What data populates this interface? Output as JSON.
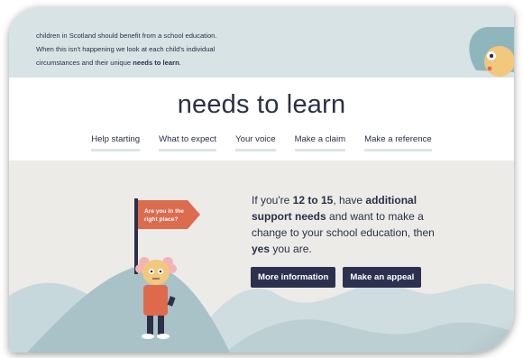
{
  "banner": {
    "intro_line1": "children in Scotland should benefit from a school education.",
    "intro_line2": "When this isn't happening we look at each child's individual",
    "intro_line3_start": "circumstances and their unique ",
    "intro_line3_bold": "needs to learn",
    "intro_line3_end": "."
  },
  "page": {
    "title": "needs to learn"
  },
  "nav": {
    "items": [
      "Help starting",
      "What to expect",
      "Your voice",
      "Make a claim",
      "Make a reference"
    ]
  },
  "hero": {
    "flag_line1": "Are you in the",
    "flag_line2": "right place?",
    "text": {
      "p1": "If you're ",
      "b1": "12 to 15",
      "p2": ", have ",
      "b2": "additional support needs",
      "p3": " and want to make a change to your school education, then ",
      "b3": "yes",
      "p4": " you are."
    },
    "buttons": {
      "more_info": "More information",
      "appeal": "Make an appeal"
    }
  },
  "colors": {
    "navy": "#2b3048",
    "button": "#2d3150",
    "banner_bg": "#d7e3e5",
    "hero_bg": "#ecebe7",
    "hill": "#a9c2c7",
    "flag": "#dd6b4e",
    "character_body": "#df6a4b"
  },
  "icons": [
    "flag-icon",
    "character-illustration",
    "banner-face-illustration"
  ]
}
